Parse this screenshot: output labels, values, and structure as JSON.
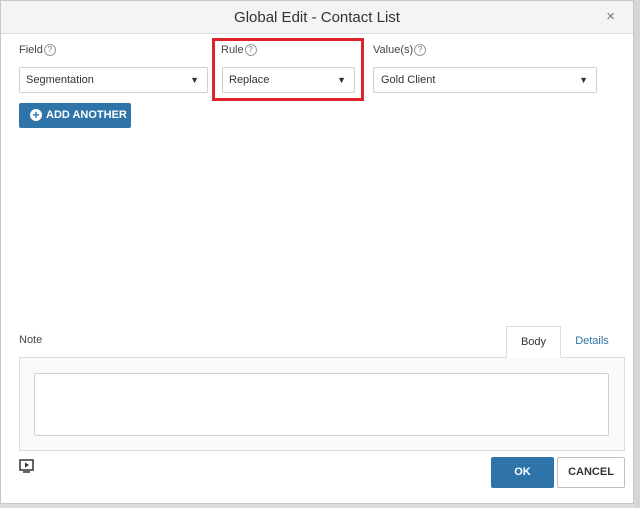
{
  "dialog": {
    "title": "Global Edit - Contact List",
    "close_glyph": "×"
  },
  "fields": {
    "field": {
      "label": "Field",
      "help": "?",
      "value": "Segmentation"
    },
    "rule": {
      "label": "Rule",
      "help": "?",
      "value": "Replace"
    },
    "values": {
      "label": "Value(s)",
      "help": "?",
      "value": "Gold Client"
    }
  },
  "caret_glyph": "▼",
  "add_another": {
    "label": "ADD ANOTHER",
    "icon": "plus-circle-icon"
  },
  "note": {
    "label": "Note",
    "tabs": [
      {
        "label": "Body",
        "active": true
      },
      {
        "label": "Details",
        "active": false
      }
    ],
    "body_value": ""
  },
  "footer": {
    "ok_label": "OK",
    "cancel_label": "CANCEL",
    "media_icon": "video-play-icon"
  },
  "colors": {
    "accent": "#2e74a8",
    "highlight": "#e0232b"
  }
}
